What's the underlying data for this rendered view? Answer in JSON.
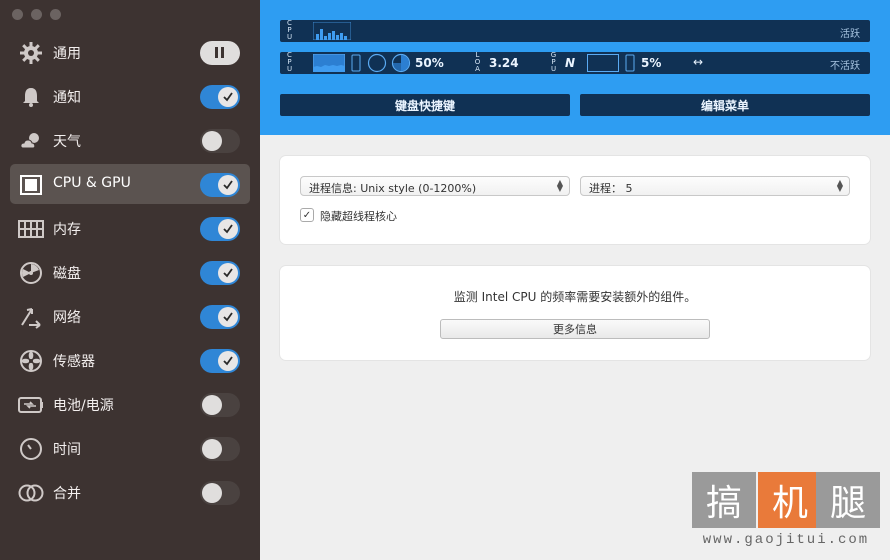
{
  "sidebar": {
    "items": [
      {
        "label": "通用",
        "icon": "gear-icon",
        "state": "paused"
      },
      {
        "label": "通知",
        "icon": "bell-icon",
        "state": "on"
      },
      {
        "label": "天气",
        "icon": "weather-icon",
        "state": "off"
      },
      {
        "label": "CPU & GPU",
        "icon": "cpu-icon",
        "state": "on",
        "selected": true
      },
      {
        "label": "内存",
        "icon": "memory-icon",
        "state": "on"
      },
      {
        "label": "磁盘",
        "icon": "disk-icon",
        "state": "on"
      },
      {
        "label": "网络",
        "icon": "network-icon",
        "state": "on"
      },
      {
        "label": "传感器",
        "icon": "sensor-icon",
        "state": "on"
      },
      {
        "label": "电池/电源",
        "icon": "battery-icon",
        "state": "off"
      },
      {
        "label": "时间",
        "icon": "clock-icon",
        "state": "off"
      },
      {
        "label": "合并",
        "icon": "merge-icon",
        "state": "off"
      }
    ]
  },
  "header": {
    "row1": {
      "cpu_label": "CPU",
      "status": "活跃"
    },
    "row2": {
      "cpu_label": "CPU",
      "cpu_percent": "50%",
      "load_label": "LOAD",
      "load_value": "3.24",
      "gpu_label": "GPU",
      "gpu_symbol": "N",
      "gpu_percent": "5%",
      "status": "不活跃"
    },
    "keyboard_shortcut_button": "键盘快捷键",
    "edit_menu_button": "编辑菜单"
  },
  "settings": {
    "process_info_select": "进程信息: Unix style (0-1200%)",
    "process_count_select": "进程： 5",
    "hide_hyperthreading_label": "隐藏超线程核心",
    "hide_hyperthreading_checked": true
  },
  "intel_notice": {
    "text": "监测 Intel CPU 的频率需要安装额外的组件。",
    "more_info_button": "更多信息"
  },
  "watermark": {
    "chars": [
      "搞",
      "机",
      "腿"
    ],
    "url": "www.gaojitui.com"
  },
  "colors": {
    "sidebar_bg": "#3d3331",
    "header_bg": "#2e9df2",
    "bar_bg": "#103154",
    "toggle_on": "#2f86d6"
  }
}
